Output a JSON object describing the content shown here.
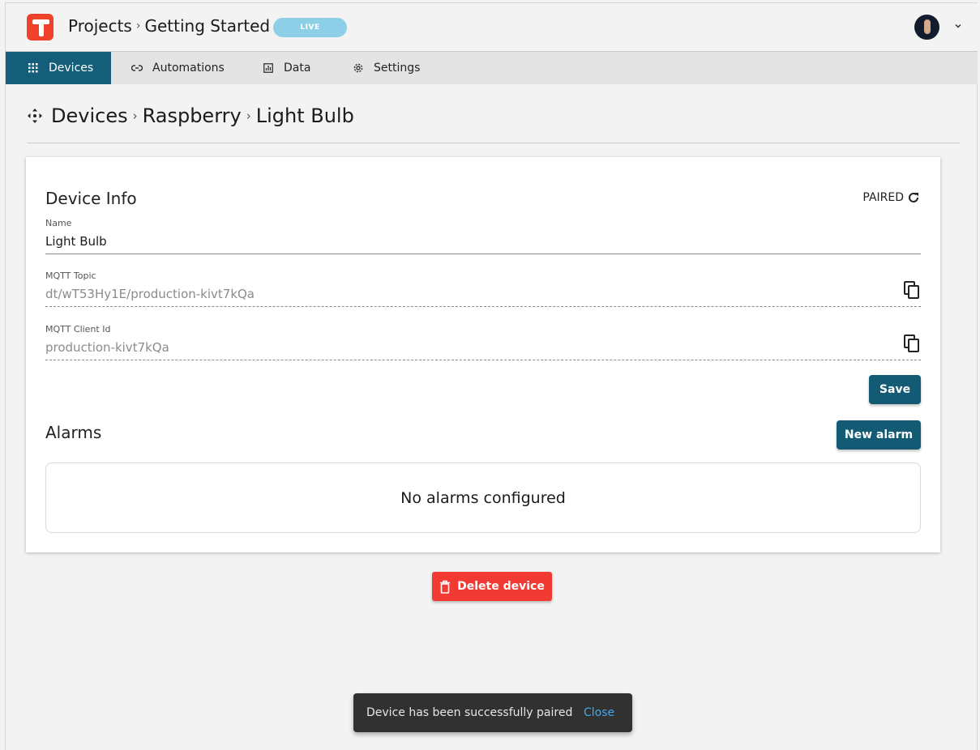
{
  "header": {
    "breadcrumb": [
      "Projects",
      "Getting Started"
    ],
    "separator": "›",
    "status_badge": "LIVE",
    "user_menu_icon": "chevron-down-icon"
  },
  "tabs": [
    {
      "label": "Devices",
      "icon": "grid-icon",
      "active": true
    },
    {
      "label": "Automations",
      "icon": "link-icon",
      "active": false
    },
    {
      "label": "Data",
      "icon": "bar-chart-icon",
      "active": false
    },
    {
      "label": "Settings",
      "icon": "gear-icon",
      "active": false
    }
  ],
  "page": {
    "breadcrumb": [
      "Devices",
      "Raspberry",
      "Light Bulb"
    ],
    "separator": "›",
    "icon": "move-arrows-icon"
  },
  "device_info": {
    "title": "Device Info",
    "status": "PAIRED",
    "fields": [
      {
        "label": "Name",
        "value": "Light Bulb"
      },
      {
        "label": "MQTT Topic",
        "value": "dt/wT53Hy1E/production-kivt7kQa"
      },
      {
        "label": "MQTT Client Id",
        "value": "production-kivt7kQa"
      }
    ],
    "save_label": "Save"
  },
  "alarms": {
    "title": "Alarms",
    "new_label": "New alarm",
    "empty_text": "No alarms configured"
  },
  "delete_label": "Delete device",
  "snackbar": {
    "message": "Device has been successfully paired",
    "close_label": "Close"
  },
  "colors": {
    "primary": "#135a74",
    "danger": "#f13a33",
    "brand": "#f0422b",
    "badge": "#8ecfe8",
    "link": "#44a7e8"
  }
}
